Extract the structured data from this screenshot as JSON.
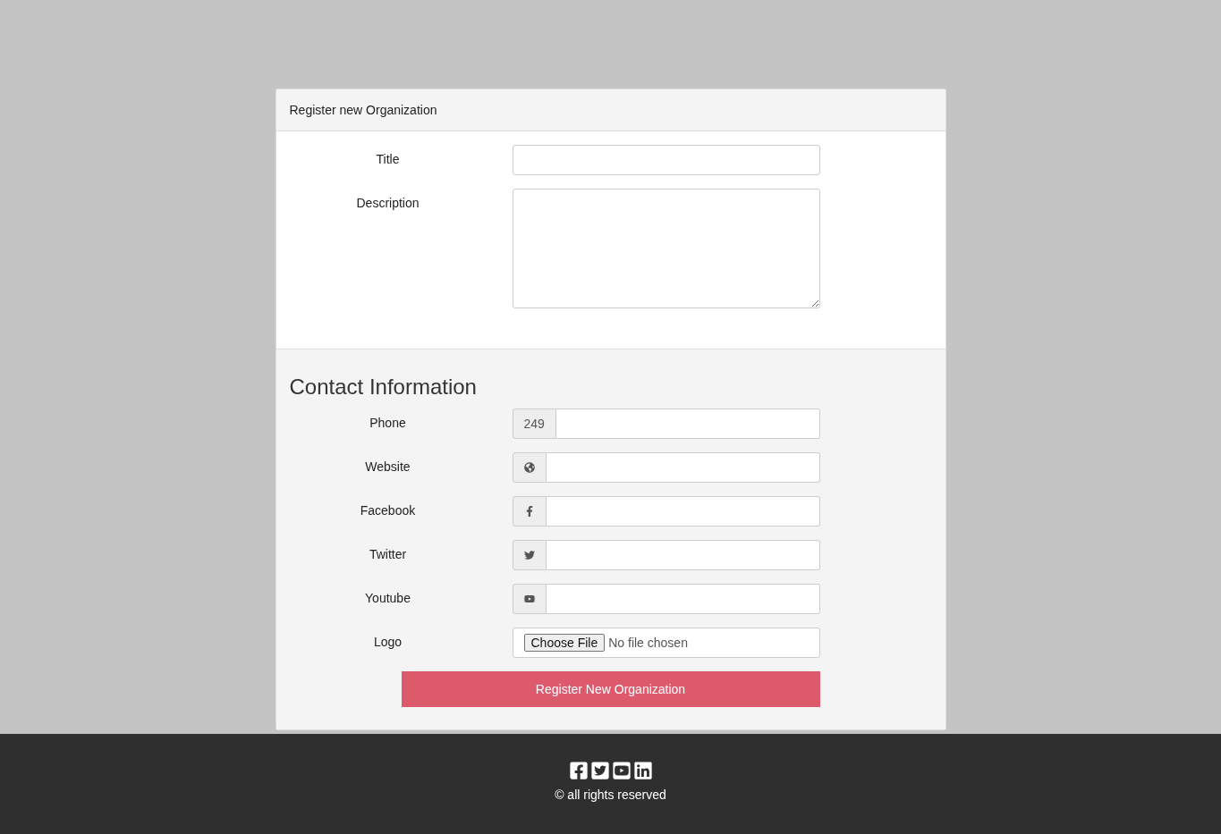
{
  "card": {
    "title": "Register new Organization"
  },
  "basic_fields": [
    {
      "label": "Title",
      "kind": "input"
    },
    {
      "label": "Description",
      "kind": "textarea"
    }
  ],
  "contact": {
    "heading": "Contact Information",
    "fields": [
      {
        "label": "Phone",
        "kind": "addon-text",
        "addon": "249"
      },
      {
        "label": "Website",
        "kind": "addon-icon"
      },
      {
        "label": "Facebook",
        "kind": "addon-icon"
      },
      {
        "label": "Twitter",
        "kind": "addon-icon"
      },
      {
        "label": "Youtube",
        "kind": "addon-icon"
      },
      {
        "label": "Logo",
        "kind": "file",
        "button": "Choose File",
        "status": "No file chosen"
      }
    ]
  },
  "submit": "Register New Organization",
  "footer": {
    "copyright": "© all rights reserved"
  }
}
